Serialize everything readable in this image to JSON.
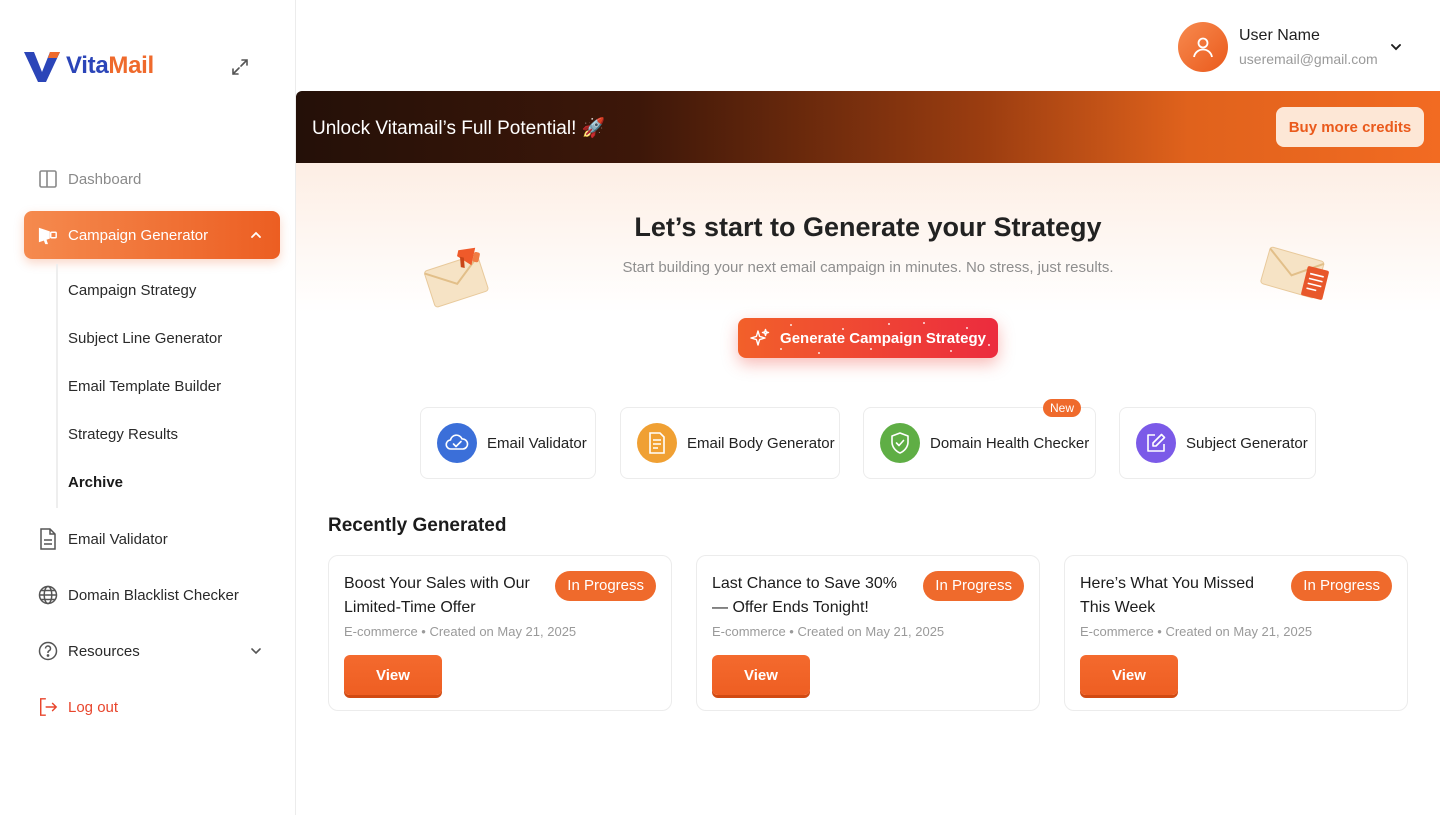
{
  "brand": {
    "part1": "Vita",
    "part2": "Mail"
  },
  "sidebar": {
    "items": [
      {
        "label": "Dashboard",
        "icon": "panel-icon"
      },
      {
        "label": "Campaign Generator",
        "icon": "megaphone-icon"
      },
      {
        "label": "Email Validator",
        "icon": "document-icon"
      },
      {
        "label": "Domain Blacklist Checker",
        "icon": "globe-icon"
      },
      {
        "label": "Resources",
        "icon": "help-circle-icon"
      },
      {
        "label": "Log out",
        "icon": "logout-icon"
      }
    ],
    "subitems": [
      {
        "label": "Campaign Strategy"
      },
      {
        "label": "Subject Line Generator"
      },
      {
        "label": "Email Template Builder"
      },
      {
        "label": "Strategy Results"
      },
      {
        "label": "Archive"
      }
    ]
  },
  "user": {
    "name": "User Name",
    "email": "useremail@gmail.com"
  },
  "banner": {
    "text": "Unlock Vitamail’s Full Potential! 🚀",
    "button": "Buy more credits"
  },
  "hero": {
    "title": "Let’s start to Generate your Strategy",
    "subtitle": "Start building your next email campaign in minutes. No stress, just results.",
    "button": "Generate Campaign Strategy"
  },
  "tools": [
    {
      "label": "Email Validator",
      "color": "#3b6fd9",
      "icon": "cloud-check-icon"
    },
    {
      "label": "Email Body Generator",
      "color": "#f0a033",
      "icon": "document-icon"
    },
    {
      "label": "Domain Health Checker",
      "color": "#5fae45",
      "icon": "shield-check-icon",
      "badge": "New"
    },
    {
      "label": "Subject Generator",
      "color": "#7b5ae8",
      "icon": "edit-icon"
    }
  ],
  "recent": {
    "title": "Recently Generated",
    "cards": [
      {
        "title": "Boost Your Sales with Our Limited-Time Offer",
        "status": "In Progress",
        "meta": "E-commerce • Created on May 21, 2025",
        "button": "View"
      },
      {
        "title": "Last Chance to Save 30% — Offer Ends Tonight!",
        "status": "In Progress",
        "meta": "E-commerce • Created on May 21, 2025",
        "button": "View"
      },
      {
        "title": "Here’s What You Missed This Week",
        "status": "In Progress",
        "meta": "E-commerce • Created on May 21, 2025",
        "button": "View"
      }
    ]
  },
  "colors": {
    "accent": "#ef6a2c",
    "brand_blue": "#2b45b8"
  }
}
